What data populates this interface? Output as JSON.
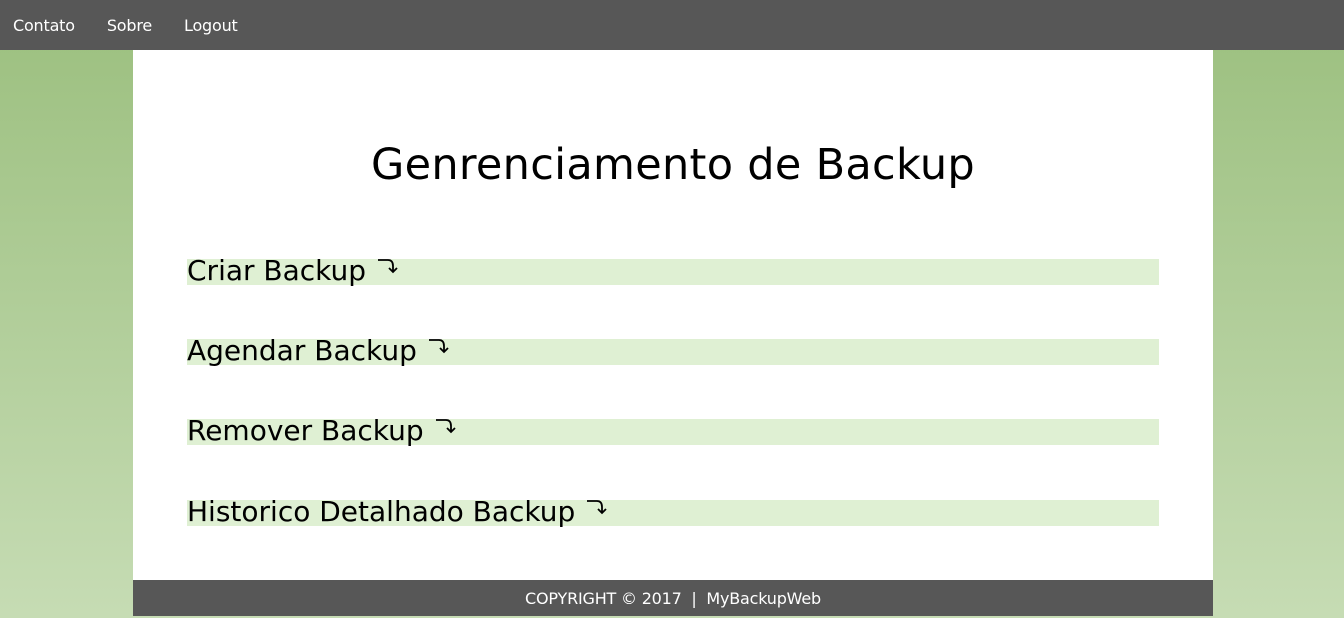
{
  "nav": {
    "items": [
      {
        "label": "Contato"
      },
      {
        "label": "Sobre"
      },
      {
        "label": "Logout"
      }
    ]
  },
  "main": {
    "title": "Genrenciamento de Backup",
    "actions": [
      {
        "label": "Criar Backup",
        "icon": "curved-arrow-icon"
      },
      {
        "label": "Agendar Backup",
        "icon": "curved-arrow-icon"
      },
      {
        "label": "Remover Backup",
        "icon": "curved-arrow-icon"
      },
      {
        "label": "Historico Detalhado Backup",
        "icon": "curved-arrow-icon"
      }
    ]
  },
  "footer": {
    "text": "COPYRIGHT © 2017  |  MyBackupWeb"
  },
  "colors": {
    "nav_bg": "#575757",
    "page_bg_top": "#9bbf7e",
    "page_bg_bottom": "#c6dcb4",
    "panel_bg": "#ffffff",
    "action_bg": "#dff0d3"
  }
}
